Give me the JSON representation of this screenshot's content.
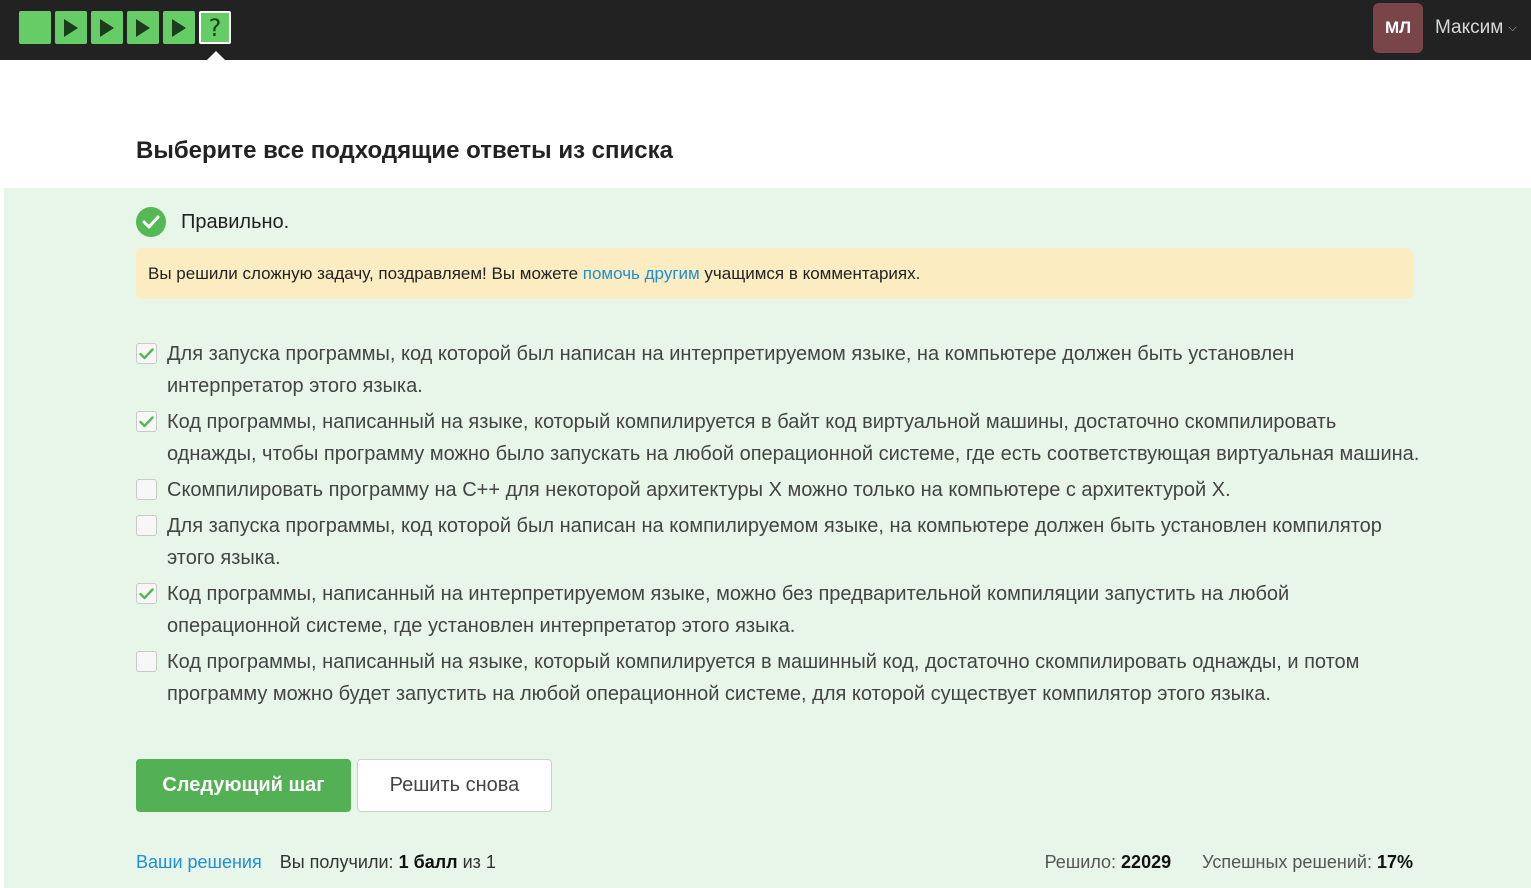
{
  "header": {
    "steps": [
      {
        "state": "passed-text",
        "icon": "square-icon"
      },
      {
        "state": "passed-code",
        "icon": "play-icon"
      },
      {
        "state": "passed-code",
        "icon": "play-icon"
      },
      {
        "state": "passed-code",
        "icon": "play-icon"
      },
      {
        "state": "passed-code",
        "icon": "play-icon"
      },
      {
        "state": "current-quiz",
        "icon": "question-icon",
        "label": "?"
      }
    ],
    "avatar_initials": "МЛ",
    "username": "Максим"
  },
  "quiz": {
    "title": "Выберите все подходящие ответы из списка",
    "status": "Правильно.",
    "notice": {
      "before": "Вы решили сложную задачу, поздравляем! Вы можете ",
      "link": "помочь другим",
      "after": " учащимся в комментариях."
    },
    "options": [
      {
        "checked": true,
        "text": "Для запуска программы, код которой был написан на интерпретируемом языке, на компьютере должен быть установлен интерпретатор этого языка."
      },
      {
        "checked": true,
        "text": "Код программы, написанный на языке, который компилируется в байт код виртуальной машины, достаточно скомпилировать однажды, чтобы программу можно было запускать на любой операционной системе, где есть соответствующая виртуальная машина."
      },
      {
        "checked": false,
        "text": "Скомпилировать программу на C++ для некоторой архитектуры X можно только на компьютере с архитектурой X."
      },
      {
        "checked": false,
        "text": "Для запуска программы, код которой был написан на компилируемом языке, на компьютере должен быть установлен компилятор этого языка."
      },
      {
        "checked": true,
        "text": "Код программы, написанный на интерпретируемом языке, можно без предварительной компиляции запустить на любой операционной системе, где установлен интерпретатор этого языка."
      },
      {
        "checked": false,
        "text": "Код программы, написанный на языке, который компилируется в машинный код, достаточно скомпилировать однажды, и потом программу можно будет запустить на любой операционной системе, для которой существует компилятор этого языка."
      }
    ],
    "next_button": "Следующий шаг",
    "retry_button": "Решить снова"
  },
  "footer": {
    "solutions_link": "Ваши решения",
    "score_label": "Вы получили:",
    "score_value": "1 балл",
    "score_of": "из 1",
    "solved_label": "Решило:",
    "solved_value": "22029",
    "success_label": "Успешных решений:",
    "success_value": "17%"
  },
  "colors": {
    "topbar": "#222222",
    "step_green": "#66cc66",
    "panel_bg": "#e7f6e8",
    "notice_bg": "#fcecc1",
    "link": "#1d8fd7",
    "primary_button": "#54b054",
    "avatar_bg": "#7a4549"
  }
}
